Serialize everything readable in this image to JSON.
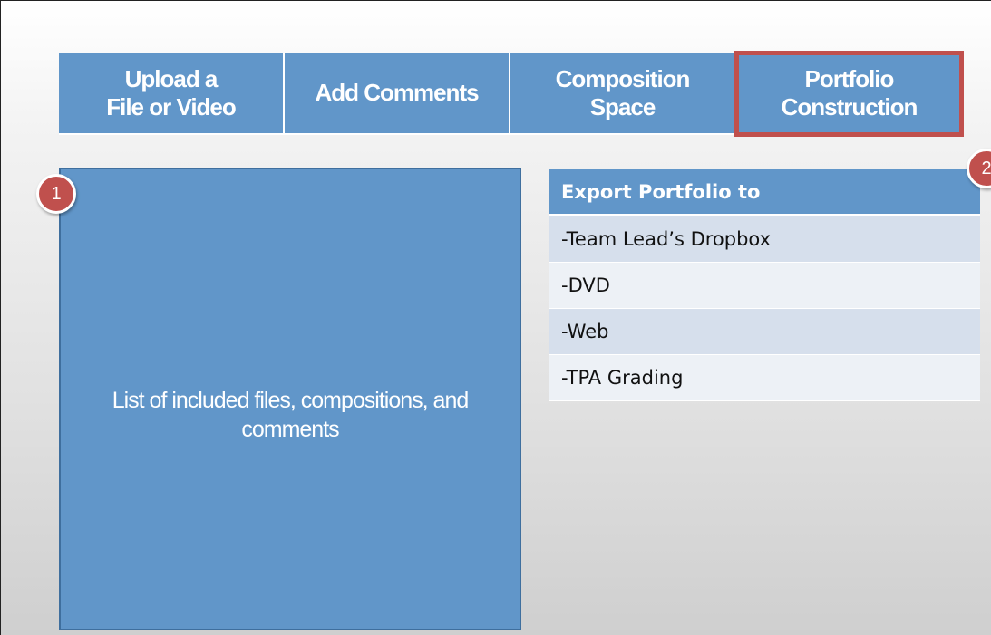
{
  "tabs": [
    {
      "label": "Upload a\nFile or Video"
    },
    {
      "label": "Add Comments"
    },
    {
      "label": "Composition\nSpace"
    },
    {
      "label": "Portfolio\nConstruction"
    }
  ],
  "active_tab": "Portfolio Construction",
  "left_panel": {
    "text": "List of included files, compositions, and comments"
  },
  "badges": {
    "one": "1",
    "two": "2"
  },
  "export": {
    "header": "Export Portfolio to",
    "options": [
      "-Team Lead’s Dropbox",
      "-DVD",
      "-Web",
      "-TPA Grading"
    ]
  },
  "colors": {
    "tab_blue": "#6196c9",
    "highlight_red": "#c0504d",
    "row_light": "#d6dfec",
    "row_lighter": "#edf1f6"
  }
}
